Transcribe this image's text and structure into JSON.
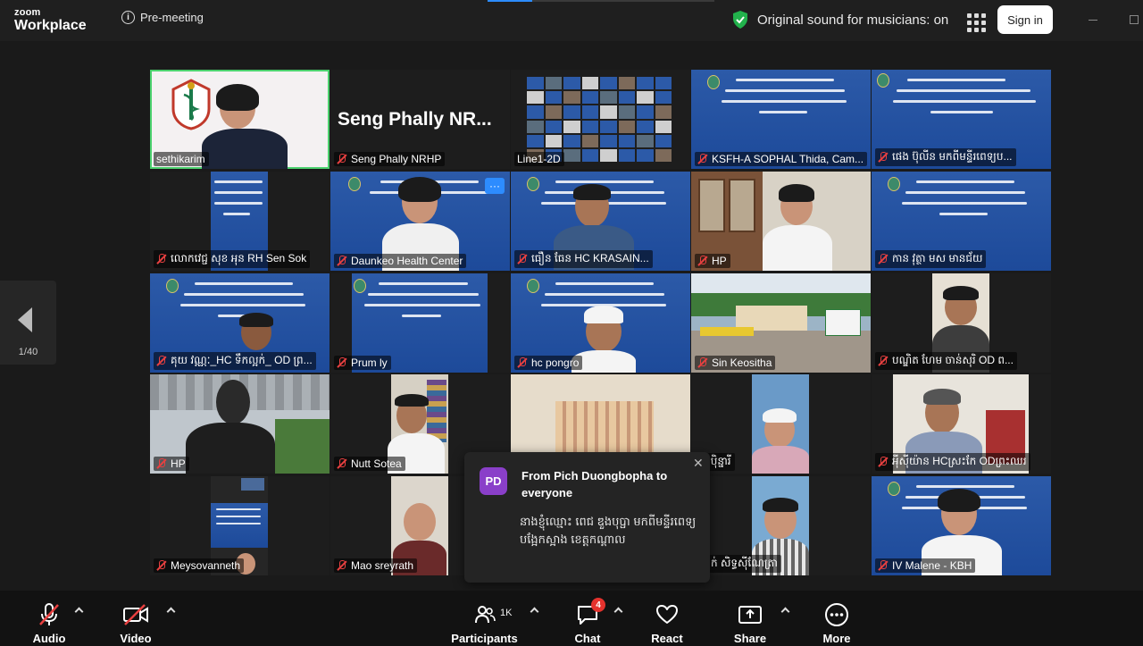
{
  "topbar": {
    "logo_small": "zoom",
    "logo_large": "Workplace",
    "meeting_state": "Pre-meeting",
    "original_sound": "Original sound for musicians: on",
    "signin_label": "Sign in"
  },
  "gallery": {
    "page_indicator": "1/40",
    "tiles": [
      {
        "name": "sethikarim",
        "muted": false
      },
      {
        "name": "Seng Phally NRHP",
        "muted": true,
        "display_text": "Seng Phally NR..."
      },
      {
        "name": "Line1-2D",
        "muted": false
      },
      {
        "name": "KSFH-A SOPHAL Thida, Cam...",
        "muted": true
      },
      {
        "name": "ផេង ប៊ុលីន មកពីមន្ទីរពេទ្យប...",
        "muted": true
      },
      {
        "name": "លោកវេជ្ជ សុខ អុន RH Sen Sok",
        "muted": true
      },
      {
        "name": "Daunkeo Health Center",
        "muted": true
      },
      {
        "name": "ធឿន  ធែន      HC KRASAIN...",
        "muted": true
      },
      {
        "name": "HP",
        "muted": true
      },
      {
        "name": "កាន វុត្ថា មស មានជ័យ",
        "muted": true
      },
      {
        "name": "គុយ វណ្ណៈ_HC ទឹកល្អក់_ OD ព្រ...",
        "muted": true
      },
      {
        "name": "Prum ly",
        "muted": true
      },
      {
        "name": "hc pongro",
        "muted": true
      },
      {
        "name": "Sin Keositha",
        "muted": true
      },
      {
        "name": "បណ្ឌិត ហែម ចាន់សុរិ OD ព...",
        "muted": true
      },
      {
        "name": "HP",
        "muted": true
      },
      {
        "name": "Nutt Sotea",
        "muted": true
      },
      {
        "name": "",
        "muted": false
      },
      {
        "name": "ឬរ បុិន្នារី",
        "muted": false
      },
      {
        "name": "អុីស៊ីយ៉ាន HCស្រះកែ ODព្រះឈរ",
        "muted": true
      },
      {
        "name": "Meysovanneth",
        "muted": true
      },
      {
        "name": "Mao sreyrath",
        "muted": true
      },
      {
        "name": "",
        "muted": false
      },
      {
        "name": "ប្រាក់ សិទ្ធស៊ីណែត្រា",
        "muted": false
      },
      {
        "name": "IV Malene - KBH",
        "muted": true
      }
    ]
  },
  "chat_popup": {
    "avatar_initials": "PD",
    "from": "From Pich Duongbopha to everyone",
    "message": "នាងខ្ញុំឈ្មោះ ពេជ ឌួងបុប្ផា មកពីមន្ទីរពេទ្យបង្អែកស្អាង ខេត្តកណ្ដាល",
    "close_label": "✕"
  },
  "toolbar": {
    "audio_label": "Audio",
    "video_label": "Video",
    "participants_label": "Participants",
    "participants_count": "1K",
    "chat_label": "Chat",
    "chat_badge": "4",
    "react_label": "React",
    "share_label": "Share",
    "more_label": "More"
  },
  "colors": {
    "active_speaker": "#4bd16e",
    "muted_icon": "#e84040",
    "banner_blue": "#1d4a9a",
    "chat_avatar": "#8a3fc9",
    "badge_red": "#e5322d"
  }
}
